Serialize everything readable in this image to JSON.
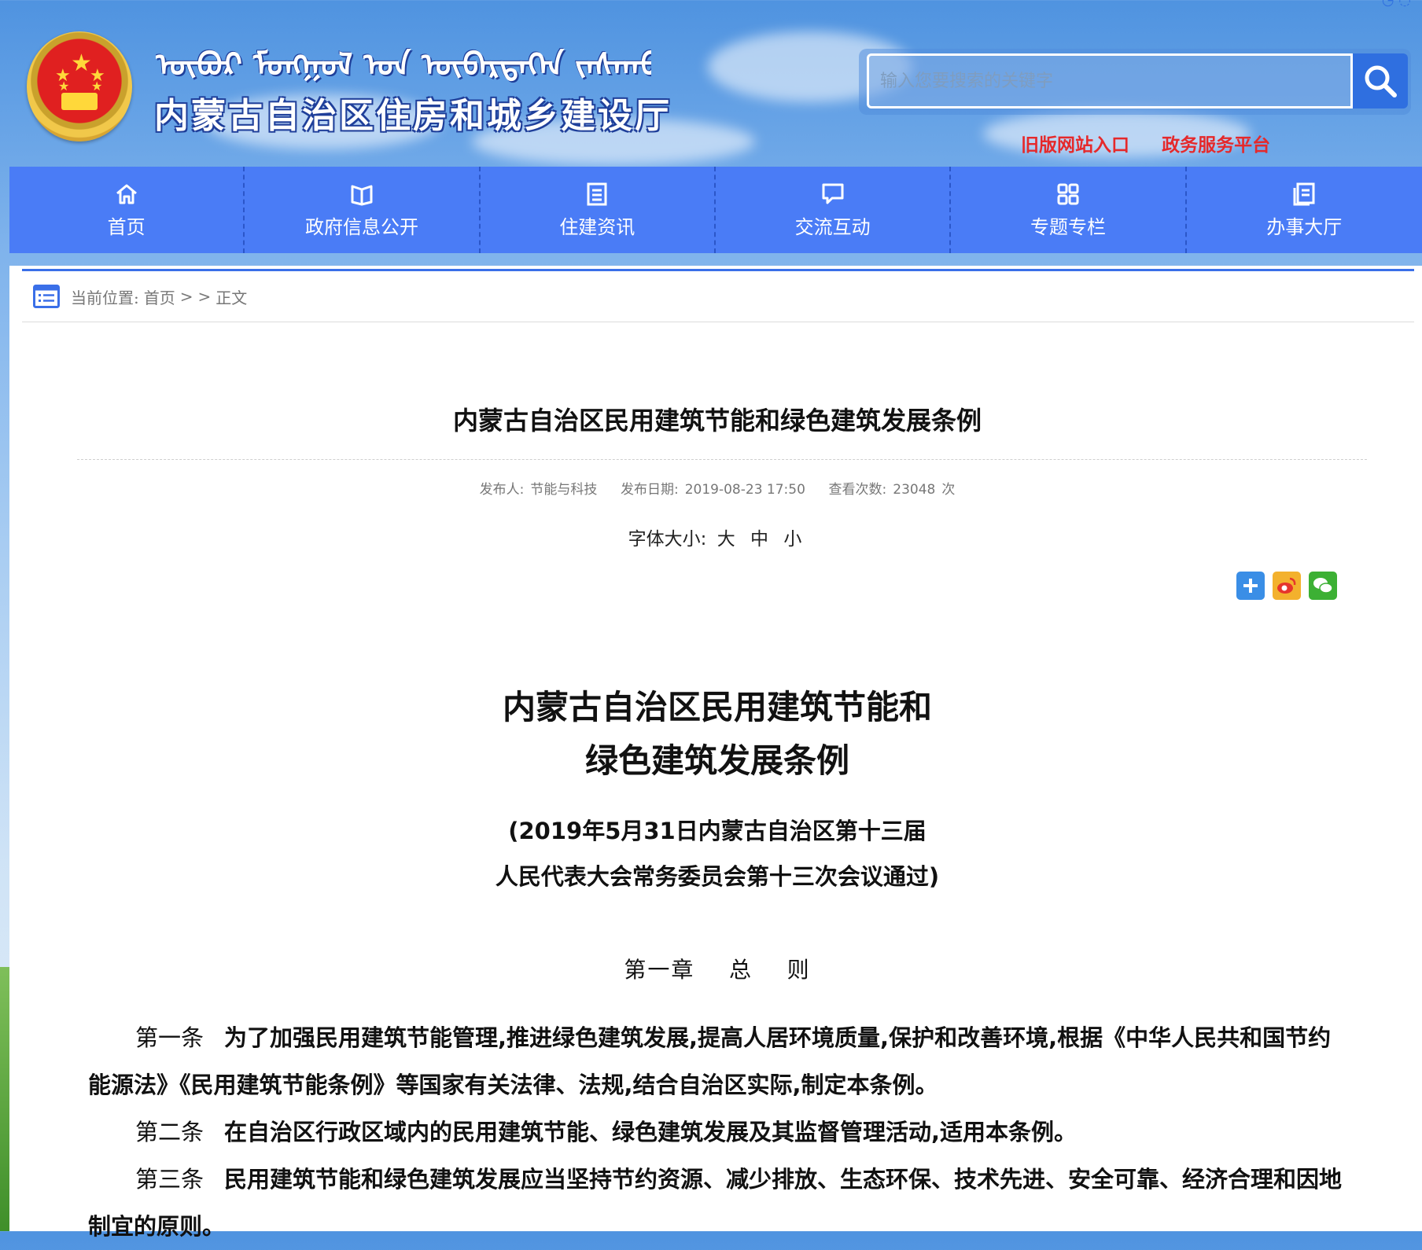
{
  "header": {
    "mongolian_title": "ᠥᠪᠦᠷ ᠮᠣᠩᠭᠣᠯ ᠤᠨ ᠥᠪᠡᠷᠲᠡᠭᠡᠨ ᠵᠠᠰᠠᠬᠤ ᠣᠷᠣᠨ",
    "site_title": "内蒙古自治区住房和城乡建设厅",
    "search_placeholder": "输入您要搜索的关键字",
    "links": [
      "旧版网站入口",
      "政务服务平台"
    ]
  },
  "nav": [
    {
      "label": "首页",
      "icon": "home-icon"
    },
    {
      "label": "政府信息公开",
      "icon": "book-icon"
    },
    {
      "label": "住建资讯",
      "icon": "document-icon"
    },
    {
      "label": "交流互动",
      "icon": "chat-icon"
    },
    {
      "label": "专题专栏",
      "icon": "grid-icon"
    },
    {
      "label": "办事大厅",
      "icon": "clipboard-icon"
    }
  ],
  "breadcrumb": {
    "prefix": "当前位置:",
    "home": "首页",
    "sep": ">",
    "current": "正文"
  },
  "article": {
    "title": "内蒙古自治区民用建筑节能和绿色建筑发展条例",
    "meta": {
      "publisher_label": "发布人:",
      "publisher": "节能与科技",
      "date_label": "发布日期:",
      "date": "2019-08-23 17:50",
      "views_label": "查看次数:",
      "views": "23048",
      "views_unit": "次"
    },
    "font_size_label": "字体大小:",
    "font_size_options": [
      "大",
      "中",
      "小"
    ],
    "share_icons": [
      "plus-share-icon",
      "weibo-icon",
      "wechat-icon"
    ],
    "doc_title_line1": "内蒙古自治区民用建筑节能和",
    "doc_title_line2": "绿色建筑发展条例",
    "doc_sub_line1": "(2019年5月31日内蒙古自治区第十三届",
    "doc_sub_line2": "人民代表大会常务委员会第十三次会议通过)",
    "chapter": "第一章    总    则",
    "articles": [
      {
        "no": "第一条",
        "text": "为了加强民用建筑节能管理,推进绿色建筑发展,提高人居环境质量,保护和改善环境,根据《中华人民共和国节约能源法》《民用建筑节能条例》等国家有关法律、法规,结合自治区实际,制定本条例。"
      },
      {
        "no": "第二条",
        "text": "在自治区行政区域内的民用建筑节能、绿色建筑发展及其监督管理活动,适用本条例。"
      },
      {
        "no": "第三条",
        "text": "民用建筑节能和绿色建筑发展应当坚持节约资源、减少排放、生态环保、技术先进、安全可靠、经济合理和因地制宜的原则。"
      }
    ]
  },
  "colors": {
    "nav_bg": "#4a7cf6",
    "accent": "#2f6fe0",
    "link_red": "#e5292b"
  }
}
